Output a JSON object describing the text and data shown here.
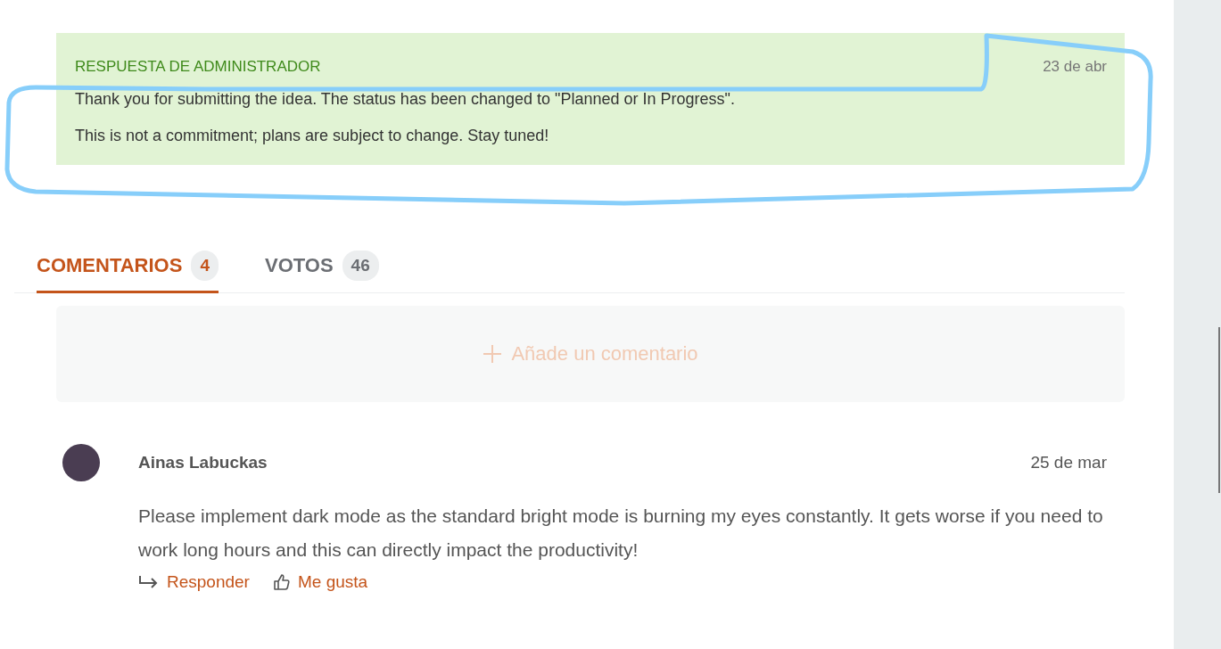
{
  "admin_reply": {
    "label": "RESPUESTA DE ADMINISTRADOR",
    "date": "23 de abr",
    "paragraphs": [
      "Thank you for submitting the idea. The status has been changed to \"Planned or In Progress\".",
      "This is not a commitment; plans are subject to change. Stay tuned!"
    ]
  },
  "tabs": [
    {
      "label": "COMENTARIOS",
      "count": "4",
      "selected": true
    },
    {
      "label": "VOTOS",
      "count": "46",
      "selected": false
    }
  ],
  "add_comment": {
    "label": "Añade un comentario"
  },
  "comments": [
    {
      "author": "Ainas Labuckas",
      "date": "25 de mar",
      "text": "Please implement dark mode as the standard bright mode is burning my eyes constantly. It gets worse if you need to work long hours and this can directly impact the productivity!",
      "reply_label": "Responder",
      "like_label": "Me gusta"
    }
  ]
}
